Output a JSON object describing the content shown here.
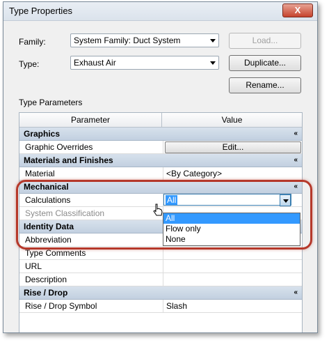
{
  "window": {
    "title": "Type Properties",
    "close_label": "X"
  },
  "family": {
    "label": "Family:",
    "value": "System Family: Duct System"
  },
  "type": {
    "label": "Type:",
    "value": "Exhaust Air"
  },
  "buttons": {
    "load": "Load...",
    "duplicate": "Duplicate...",
    "rename": "Rename..."
  },
  "section_label": "Type Parameters",
  "grid": {
    "header": {
      "parameter": "Parameter",
      "value": "Value"
    },
    "groups": {
      "graphics": "Graphics",
      "materials": "Materials and Finishes",
      "mechanical": "Mechanical",
      "identity": "Identity Data",
      "rise": "Rise / Drop"
    },
    "rows": {
      "graphic_overrides": {
        "name": "Graphic Overrides",
        "button": "Edit..."
      },
      "material": {
        "name": "Material",
        "value": "<By Category>"
      },
      "calculations": {
        "name": "Calculations",
        "value": "All"
      },
      "system_classification": {
        "name": "System Classification"
      },
      "abbreviation": {
        "name": "Abbreviation"
      },
      "type_comments": {
        "name": "Type Comments"
      },
      "url": {
        "name": "URL"
      },
      "description": {
        "name": "Description"
      },
      "rise_drop_symbol": {
        "name": "Rise / Drop Symbol",
        "value": "Slash"
      }
    },
    "collapse_glyph": "«"
  },
  "calculations_dropdown": {
    "options": [
      "All",
      "Flow only",
      "None"
    ],
    "selected": "All"
  },
  "colors": {
    "highlight": "#b5382a",
    "group_header": "#c2d0e0",
    "selection": "#3399ff"
  },
  "icons": {
    "collapse": "chevron-double-up-icon",
    "cursor": "hand-pointer-icon"
  }
}
